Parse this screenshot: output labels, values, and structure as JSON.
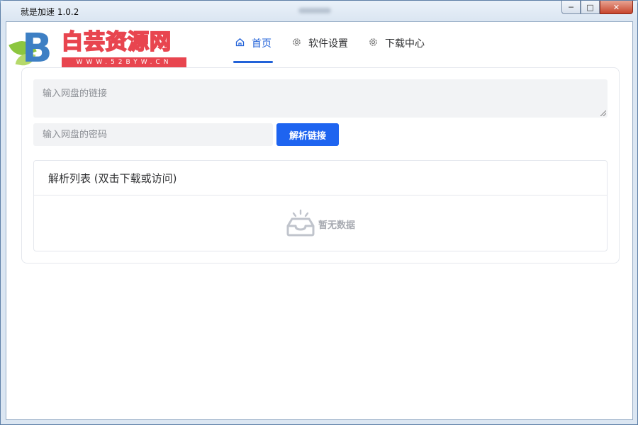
{
  "window": {
    "title": "就是加速 1.0.2",
    "buttons": {
      "minimize": "─",
      "maximize": "□",
      "close": "✕"
    }
  },
  "logo": {
    "letter": "B",
    "text": "白芸资源网",
    "sub": "WWW.52BYW.CN"
  },
  "tabs": [
    {
      "label": "首页",
      "icon": "home-icon",
      "active": true
    },
    {
      "label": "软件设置",
      "icon": "gear-icon",
      "active": false
    },
    {
      "label": "下载中心",
      "icon": "gear-icon",
      "active": false
    }
  ],
  "form": {
    "link_placeholder": "输入网盘的链接",
    "link_value": "",
    "password_placeholder": "输入网盘的密码",
    "password_value": "",
    "parse_button": "解析链接"
  },
  "list": {
    "title": "解析列表 (双击下载或访问)",
    "empty_text": "暂无数据"
  },
  "colors": {
    "accent": "#2262d8",
    "button": "#1e64f0",
    "input_bg": "#f2f3f5",
    "border": "#e4e7ed",
    "logo_red": "#e8454f",
    "logo_blue": "#3d7fc4",
    "logo_green": "#8cc63f"
  }
}
